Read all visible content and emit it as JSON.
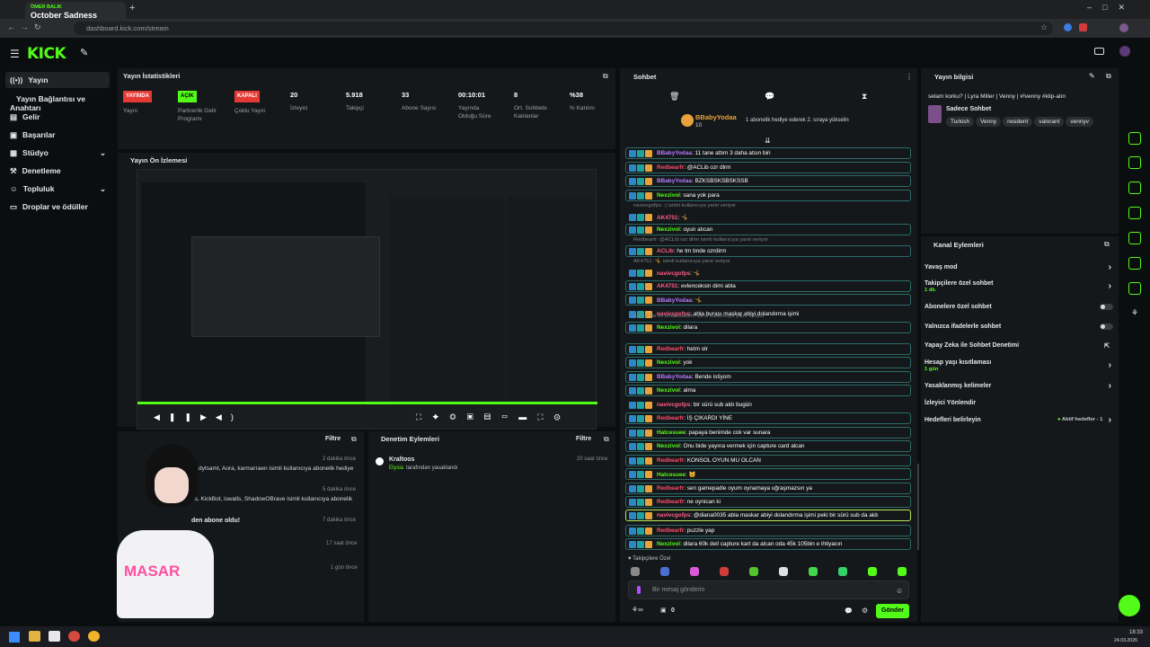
{
  "browser": {
    "tab_user": "ÖMER BALIK",
    "tab_title": "October Sadness",
    "url": "dashboard.kick.com/stream"
  },
  "app": {
    "logo": "KICK"
  },
  "nav": {
    "items": [
      {
        "label": "Yayın",
        "active": true
      },
      {
        "label": "Yayın Bağlantısı ve Anahtarı"
      },
      {
        "label": "Gelir"
      },
      {
        "label": "Başarılar"
      },
      {
        "label": "Stüdyo"
      },
      {
        "label": "Denetleme"
      },
      {
        "label": "Topluluk"
      },
      {
        "label": "Droplar ve ödüller"
      }
    ]
  },
  "stats": {
    "title": "Yayın İstatistikleri",
    "items": [
      {
        "badge": "YAYINDA",
        "label": "Yayın",
        "color": "#e53935"
      },
      {
        "badge": "AÇIK",
        "label": "Partnerlik Gelir Programı",
        "color": "#53fc18"
      },
      {
        "badge": "KAPALI",
        "label": "Çoklu Yayın",
        "color": "#e53935"
      },
      {
        "value": "20",
        "label": "İzleyici"
      },
      {
        "value": "5.918",
        "label": "Takipçi"
      },
      {
        "value": "33",
        "label": "Abone Sayısı"
      },
      {
        "value": "00:10:01",
        "label": "Yayında Olduğu Süre"
      },
      {
        "value": "8",
        "label": "Ort. Sohbete Katılanlar"
      },
      {
        "value": "%38",
        "label": "% Katılım"
      }
    ]
  },
  "preview": {
    "title": "Yayın Ön İzlemesi"
  },
  "activity": {
    "filter": "Filtre",
    "rows": [
      {
        "text": "dytsamt, Aora, karmarraen isimli kullanıcıya abonelik hediye",
        "time": "2 dakika önce"
      },
      {
        "text": "ps, KickBot, iswalls, ShadowOBrave isimli kullanıcıya abonelik",
        "time": "5 dakika önce"
      },
      {
        "text": "den abone oldu!",
        "time": "7 dakika önce"
      },
      {
        "text": "",
        "time": "17 saat önce"
      },
      {
        "text": "",
        "time": "1 gün önce"
      }
    ]
  },
  "moderation": {
    "title": "Denetim Eylemleri",
    "filter": "Filtre",
    "user": "Kraltoos",
    "actor": "Elysia",
    "action": "tarafından yasaklandı",
    "time": "20 saat önce"
  },
  "chat": {
    "title": "Sohbet",
    "pinned_user": "BBabyYodaa",
    "pinned_count": "10",
    "pinned_text": "1 abonelik hediye ederek 2. sıraya yükselin",
    "messages": [
      {
        "user": "BBabyYodaa",
        "text": ": 11 tane attım 3 daha atsın biri",
        "color": "#b57cff"
      },
      {
        "user": "Redbearfr",
        "text": ": @ACLib ozr dlrm",
        "color": "#ff4d6a"
      },
      {
        "user": "BBabyYodaa",
        "text": ": BZKSBSKSBSKSSB",
        "color": "#b57cff"
      },
      {
        "user": "Nexzivol",
        "text": ": sana yok para",
        "color": "#53fc18"
      },
      {
        "user": "AK4751",
        "text": ": 🤸",
        "color": "#ff5c8a",
        "reply": "navivcgofps: :) isimli kullanıcıya yanıt veriyor"
      },
      {
        "user": "Nexzivol",
        "text": ": oyun alıcan",
        "color": "#53fc18"
      },
      {
        "user": "ACLib",
        "text": ": he tm bnde ozrdirm",
        "color": "#ff5c8a",
        "reply": "Redbearfr: @ACLib ozr dlrm isimli kullanıcıya yanıt veriyor"
      },
      {
        "user": "navivcgofps",
        "text": ": 🤸",
        "color": "#ff5c8a",
        "reply": "AK4751: 🤸 isimli kullanıcıya yanıt veriyor"
      },
      {
        "user": "AK4751",
        "text": ": evlenceksin dimi abla",
        "color": "#ff5c8a"
      },
      {
        "user": "BBabyYodaa",
        "text": ": 🤸",
        "color": "#b57cff"
      },
      {
        "user": "navivcgofps",
        "text": ": abla burası maskar abiyi dolandırma işimi",
        "color": "#ff5c8a"
      },
      {
        "user": "Nexzivol",
        "text": ": dilara",
        "color": "#53fc18",
        "reply": "ACLib: he tm bnde ozrdirm isimli kullanıcıya yanıt veriyor"
      },
      {
        "user": "Redbearfr",
        "text": ": hetm olr",
        "color": "#ff4d6a"
      },
      {
        "user": "Nexzivol",
        "text": ": yok",
        "color": "#53fc18"
      },
      {
        "user": "BBabyYodaa",
        "text": ": Bende istiyom",
        "color": "#b57cff"
      },
      {
        "user": "Nexzivol",
        "text": ": alma",
        "color": "#53fc18"
      },
      {
        "user": "navivcgofps",
        "text": ": bir sürü sub aldı bugün",
        "color": "#ff5c8a"
      },
      {
        "user": "Redbearfr",
        "text": ": İŞ ÇIKARDI YİNE",
        "color": "#ff4d6a"
      },
      {
        "user": "Hatcesuee",
        "text": ": papaya benimde cok var sunara",
        "color": "#53fc18"
      },
      {
        "user": "Nexzivol",
        "text": ": Onu bide yayına vermek için capture card alcan",
        "color": "#53fc18"
      },
      {
        "user": "Redbearfr",
        "text": ": KONSOL OYUN MU OLCAN",
        "color": "#ff4d6a"
      },
      {
        "user": "Hatcesuee",
        "text": ": 🐱",
        "color": "#53fc18"
      },
      {
        "user": "Redbearfr",
        "text": ": sen gamepadle oyum oynamaya uğraşmazsın ya",
        "color": "#ff4d6a"
      },
      {
        "user": "Redbearfr",
        "text": ": ne oynican ki",
        "color": "#ff4d6a"
      },
      {
        "user": "navivcgofps",
        "text": ": @diana0035 abla maskar abiyi dolandırma işimi peki bir sürü sub da aldı",
        "color": "#ff5c8a"
      },
      {
        "user": "Redbearfr",
        "text": ": puzzle yap",
        "color": "#ff4d6a"
      },
      {
        "user": "Nexzivol",
        "text": ": dilara 60k deil capture kart da alcan oda 45k 105bin e ihtiyacın",
        "color": "#53fc18"
      }
    ],
    "emote_label": "♥ Takipçilere Özel",
    "input_placeholder": "Bir mesaj gönderin",
    "points": "0",
    "send": "Gönder"
  },
  "stream_info": {
    "title": "Yayın bilgisi",
    "stream_title": "selam korku? | Lyra Miller | Venny | #!venny #klip-alın",
    "category": "Sadece Sohbet",
    "tags": [
      "Turkish",
      "Venny",
      "resident",
      "valorant",
      "vennyv"
    ]
  },
  "channel_actions": {
    "title": "Kanal Eylemleri",
    "rows": [
      {
        "label": "Yavaş mod",
        "type": "arrow"
      },
      {
        "label": "Takipçilere özel sohbet",
        "sub": "1 dk.",
        "type": "arrow"
      },
      {
        "label": "Abonelere özel sohbet",
        "type": "toggle"
      },
      {
        "label": "Yalnızca ifadelerle sohbet",
        "type": "toggle"
      },
      {
        "label": "Yapay Zeka ile Sohbet Denetimi",
        "type": "link"
      },
      {
        "label": "Hesap yaşı kısıtlaması",
        "sub": "1 gün",
        "type": "arrow"
      },
      {
        "label": "Yasaklanmış kelimeler",
        "type": "arrow"
      },
      {
        "label": "İzleyici Yönlendir",
        "type": "none"
      },
      {
        "label": "Hedefleri belirleyin",
        "pill": "Aktif hedefler - 1",
        "type": "arrow"
      }
    ]
  },
  "taskbar": {
    "time": "18:33",
    "date": "24.03.2026"
  }
}
